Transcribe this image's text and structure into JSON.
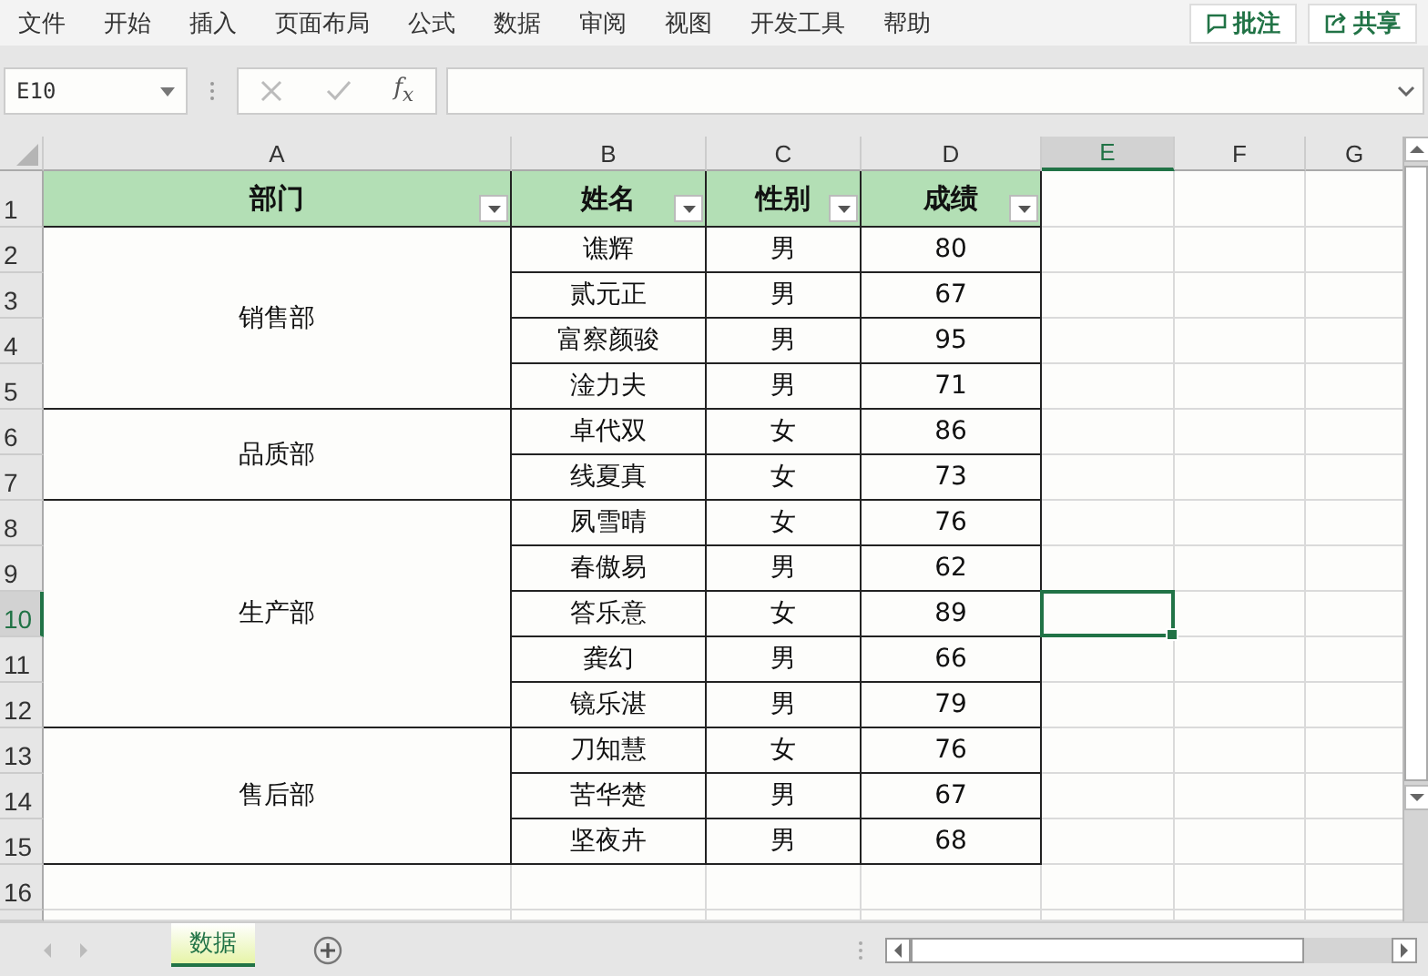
{
  "menu": [
    "文件",
    "开始",
    "插入",
    "页面布局",
    "公式",
    "数据",
    "审阅",
    "视图",
    "开发工具",
    "帮助"
  ],
  "actions": [
    {
      "kind": "comment",
      "label": "批注"
    },
    {
      "kind": "share",
      "label": "共享"
    }
  ],
  "formula_bar": {
    "name_box": "E10",
    "function_label": "f$_{x}$"
  },
  "columns": [
    {
      "label": "A",
      "selected": false
    },
    {
      "label": "B",
      "selected": false
    },
    {
      "label": "C",
      "selected": false
    },
    {
      "label": "D",
      "selected": false
    },
    {
      "label": "E",
      "selected": true
    },
    {
      "label": "F",
      "selected": false
    },
    {
      "label": "G",
      "selected": false
    }
  ],
  "row_headers": [
    {
      "label": "1",
      "selected": false
    },
    {
      "label": "2",
      "selected": false
    },
    {
      "label": "3",
      "selected": false
    },
    {
      "label": "4",
      "selected": false
    },
    {
      "label": "5",
      "selected": false
    },
    {
      "label": "6",
      "selected": false
    },
    {
      "label": "7",
      "selected": false
    },
    {
      "label": "8",
      "selected": false
    },
    {
      "label": "9",
      "selected": false
    },
    {
      "label": "10",
      "selected": true
    },
    {
      "label": "11",
      "selected": false
    },
    {
      "label": "12",
      "selected": false
    },
    {
      "label": "13",
      "selected": false
    },
    {
      "label": "14",
      "selected": false
    },
    {
      "label": "15",
      "selected": false
    },
    {
      "label": "16",
      "selected": false
    }
  ],
  "table": {
    "headers": [
      "部门",
      "姓名",
      "性别",
      "成绩"
    ],
    "groups": [
      {
        "department": "销售部",
        "rows": [
          [
            "谯辉",
            "男",
            "80"
          ],
          [
            "贰元正",
            "男",
            "67"
          ],
          [
            "富察颜骏",
            "男",
            "95"
          ],
          [
            "淦力夫",
            "男",
            "71"
          ]
        ]
      },
      {
        "department": "品质部",
        "rows": [
          [
            "卓代双",
            "女",
            "86"
          ],
          [
            "线夏真",
            "女",
            "73"
          ]
        ]
      },
      {
        "department": "生产部",
        "rows": [
          [
            "夙雪晴",
            "女",
            "76"
          ],
          [
            "春傲易",
            "男",
            "62"
          ],
          [
            "答乐意",
            "女",
            "89"
          ],
          [
            "龚幻",
            "男",
            "66"
          ],
          [
            "镜乐湛",
            "男",
            "79"
          ]
        ]
      },
      {
        "department": "售后部",
        "rows": [
          [
            "刀知慧",
            "女",
            "76"
          ],
          [
            "苦华楚",
            "男",
            "67"
          ],
          [
            "坚夜卉",
            "男",
            "68"
          ]
        ]
      }
    ]
  },
  "sheets": [
    {
      "label": "数据",
      "selected": true
    }
  ]
}
